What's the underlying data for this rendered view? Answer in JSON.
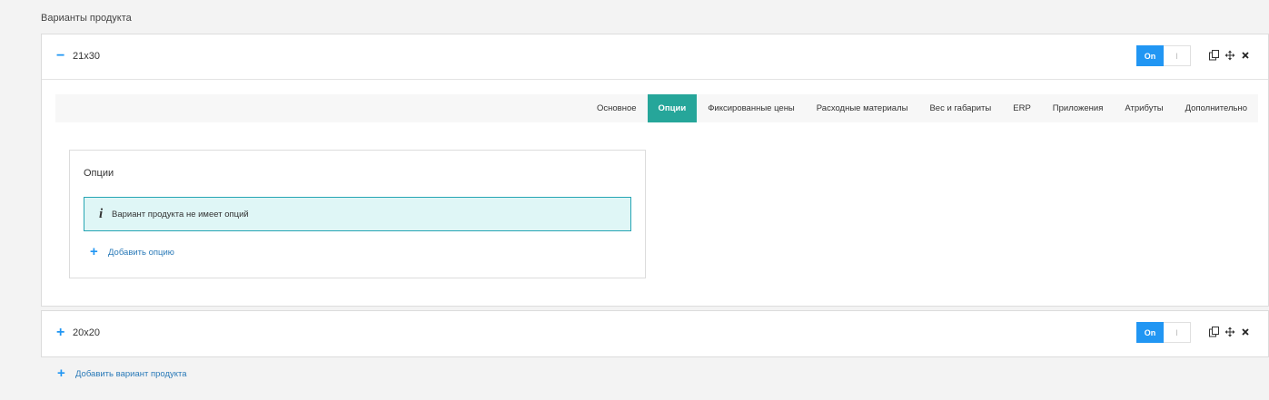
{
  "section": {
    "title": "Варианты продукта"
  },
  "variants": [
    {
      "name": "21x30",
      "toggle_symbol": "−",
      "switch_on": "On",
      "switch_off": "I",
      "tabs": [
        "Основное",
        "Опции",
        "Фиксированные цены",
        "Расходные материалы",
        "Вес и габариты",
        "ERP",
        "Приложения",
        "Атрибуты",
        "Дополнительно"
      ],
      "active_tab": "Опции",
      "options": {
        "title": "Опции",
        "info_icon": "i",
        "info_text": "Вариант продукта не имеет опций",
        "add_symbol": "+",
        "add_label": "Добавить опцию"
      }
    },
    {
      "name": "20x20",
      "toggle_symbol": "+",
      "switch_on": "On",
      "switch_off": "I"
    }
  ],
  "add_variant": {
    "symbol": "+",
    "label": "Добавить вариант продукта"
  },
  "icons": [
    "copy-icon",
    "move-icon",
    "close-icon"
  ],
  "colors": {
    "accent": "#2196f3",
    "active_tab": "#26a69a",
    "info_bg": "#dff6f6",
    "info_border": "#27a5b4",
    "link": "#2a7ab8"
  }
}
